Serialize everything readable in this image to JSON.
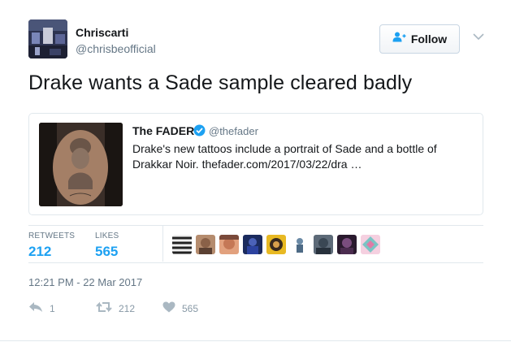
{
  "author": {
    "name": "Chriscarti",
    "handle": "@chrisbeofficial"
  },
  "follow_button": {
    "label": "Follow"
  },
  "tweet": {
    "text": "Drake wants a Sade sample cleared badly"
  },
  "quoted": {
    "name": "The FADER",
    "handle": "@thefader",
    "text": "Drake's new tattoos include a portrait of Sade and a bottle of Drakkar Noir. thefader.com/2017/03/22/dra …"
  },
  "stats": {
    "retweets_label": "RETWEETS",
    "retweets_value": "212",
    "likes_label": "LIKES",
    "likes_value": "565"
  },
  "timestamp": "12:21 PM - 22 Mar 2017",
  "actions": {
    "reply_count": "1",
    "retweet_count": "212",
    "like_count": "565"
  },
  "colors": {
    "accent": "#1da1f2",
    "secondary_text": "#657786",
    "border": "#e1e8ed",
    "icon": "#8899a6"
  }
}
